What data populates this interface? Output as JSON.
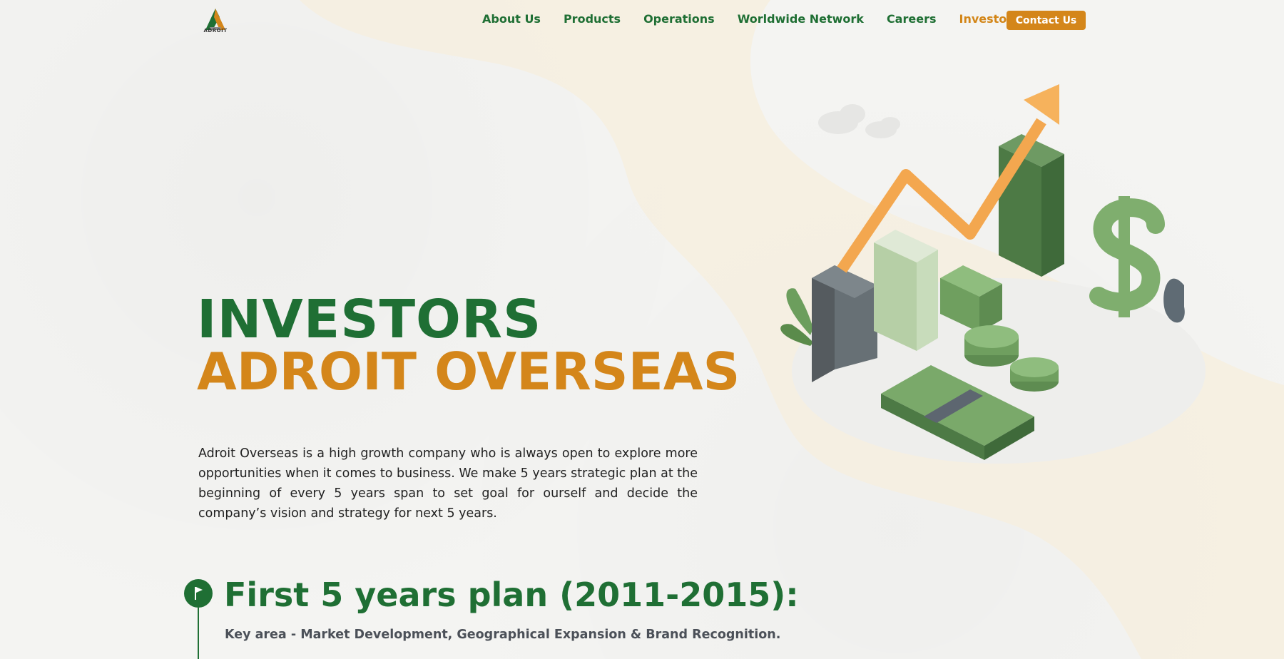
{
  "brand": {
    "logo_text": "ADROIT"
  },
  "nav": {
    "items": [
      {
        "label": "About Us"
      },
      {
        "label": "Products"
      },
      {
        "label": "Operations"
      },
      {
        "label": "Worldwide Network"
      },
      {
        "label": "Careers"
      },
      {
        "label": "Investors",
        "active": true
      }
    ],
    "contact_label": "Contact Us"
  },
  "hero": {
    "title_line1": "INVESTORS",
    "title_line2": "ADROIT OVERSEAS",
    "description": "Adroit Overseas is a high growth company who is always open to explore more opportunities when it comes to business. We make 5 years strategic plan at the beginning of every 5 years span to set goal for ourself and decide the company’s vision and strategy for next 5 years."
  },
  "plan": {
    "title": "First 5 years plan (2011-2015):",
    "subtitle": "Key area - Market Development, Geographical Expansion & Brand Recognition."
  },
  "colors": {
    "brand_green": "#1f6f34",
    "brand_orange": "#d4861a",
    "text_gray": "#4b5058"
  },
  "icons": {
    "logo": "adroit-logo-icon",
    "timeline": "flag-icon",
    "illustration": "growth-chart-illustration"
  }
}
